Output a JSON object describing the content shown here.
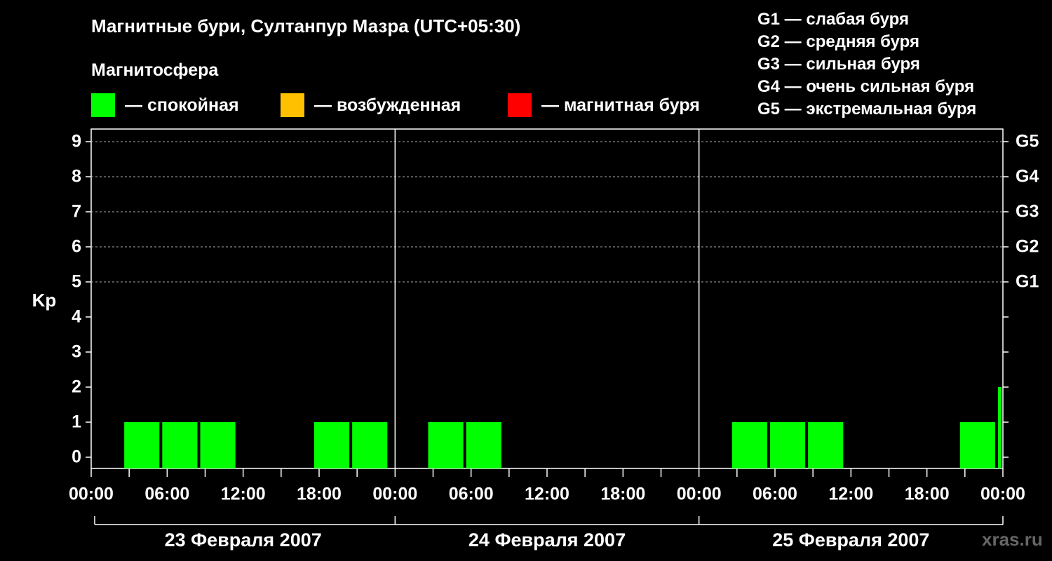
{
  "title": "Магнитные бури, Султанпур Мазра (UTC+05:30)",
  "section_label": "Магнитосфера",
  "legend": [
    {
      "label": "— спокойная",
      "color": "#00ff00"
    },
    {
      "label": "— возбужденная",
      "color": "#ffc000"
    },
    {
      "label": "— магнитная буря",
      "color": "#ff0000"
    }
  ],
  "storm_scale": [
    "G1 — слабая буря",
    "G2 — средняя буря",
    "G3 — сильная буря",
    "G4 — очень сильная буря",
    "G5 — экстремальная буря"
  ],
  "watermark": "xras.ru",
  "chart_data": {
    "type": "bar",
    "ylabel": "Kp",
    "ylim": [
      0,
      9
    ],
    "y_ticks": [
      "0",
      "1",
      "2",
      "3",
      "4",
      "5",
      "6",
      "7",
      "8",
      "9"
    ],
    "right_labels": [
      {
        "kp": 5,
        "label": "G1"
      },
      {
        "kp": 6,
        "label": "G2"
      },
      {
        "kp": 7,
        "label": "G3"
      },
      {
        "kp": 8,
        "label": "G4"
      },
      {
        "kp": 9,
        "label": "G5"
      }
    ],
    "x_tick_labels": [
      "00:00",
      "06:00",
      "12:00",
      "18:00",
      "00:00",
      "06:00",
      "12:00",
      "18:00",
      "00:00",
      "06:00",
      "12:00",
      "18:00",
      "00:00"
    ],
    "days": [
      "23 Февраля 2007",
      "24 Февраля 2007",
      "25 Февраля 2007"
    ],
    "grid": true,
    "bars": [
      {
        "day": 0,
        "start_hour": 2.5,
        "end_hour": 5.5,
        "kp": 1
      },
      {
        "day": 0,
        "start_hour": 5.5,
        "end_hour": 8.5,
        "kp": 1
      },
      {
        "day": 0,
        "start_hour": 8.5,
        "end_hour": 11.5,
        "kp": 1
      },
      {
        "day": 0,
        "start_hour": 17.5,
        "end_hour": 20.5,
        "kp": 1
      },
      {
        "day": 0,
        "start_hour": 20.5,
        "end_hour": 23.5,
        "kp": 1
      },
      {
        "day": 1,
        "start_hour": 2.5,
        "end_hour": 5.5,
        "kp": 1
      },
      {
        "day": 1,
        "start_hour": 5.5,
        "end_hour": 8.5,
        "kp": 1
      },
      {
        "day": 2,
        "start_hour": 2.5,
        "end_hour": 5.5,
        "kp": 1
      },
      {
        "day": 2,
        "start_hour": 5.5,
        "end_hour": 8.5,
        "kp": 1
      },
      {
        "day": 2,
        "start_hour": 8.5,
        "end_hour": 11.5,
        "kp": 1
      },
      {
        "day": 2,
        "start_hour": 20.5,
        "end_hour": 23.5,
        "kp": 1
      },
      {
        "day": 2,
        "start_hour": 23.5,
        "end_hour": 24.0,
        "kp": 2
      }
    ],
    "bar_color": "#00ff00"
  }
}
